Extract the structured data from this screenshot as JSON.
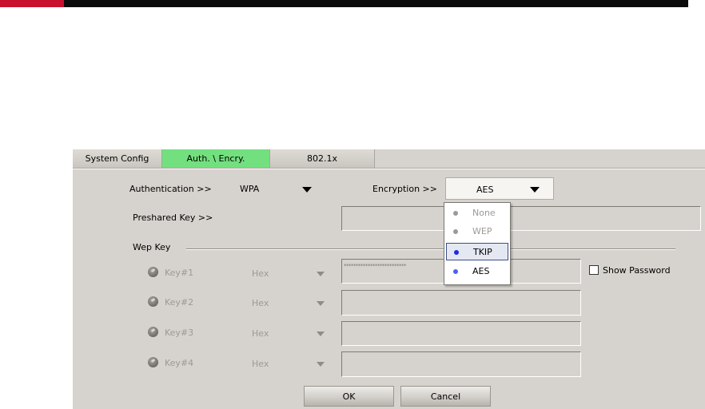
{
  "tabs": [
    {
      "label": "System Config",
      "active": false
    },
    {
      "label": "Auth. \\ Encry.",
      "active": true
    },
    {
      "label": "802.1x",
      "active": false
    }
  ],
  "authentication": {
    "label": "Authentication >>",
    "value": "WPA"
  },
  "encryption": {
    "label": "Encryption >>",
    "value": "AES",
    "options": [
      {
        "label": "None",
        "enabled": false,
        "selected": false,
        "dot_color": "#9a9a9a"
      },
      {
        "label": "WEP",
        "enabled": false,
        "selected": false,
        "dot_color": "#9a9a9a"
      },
      {
        "label": "TKIP",
        "enabled": true,
        "selected": true,
        "dot_color": "#1f2be0"
      },
      {
        "label": "AES",
        "enabled": true,
        "selected": false,
        "dot_color": "#5060f0"
      }
    ]
  },
  "preshared": {
    "label": "Preshared Key >>",
    "value": ""
  },
  "wep": {
    "group_label": "Wep Key",
    "keys": [
      {
        "label": "Key#1",
        "format": "Hex",
        "value": "**************************"
      },
      {
        "label": "Key#2",
        "format": "Hex",
        "value": ""
      },
      {
        "label": "Key#3",
        "format": "Hex",
        "value": ""
      },
      {
        "label": "Key#4",
        "format": "Hex",
        "value": ""
      }
    ]
  },
  "show_password": {
    "label": "Show Password",
    "checked": false
  },
  "buttons": {
    "ok": "OK",
    "cancel": "Cancel"
  },
  "colors": {
    "active_tab": "#73e07f",
    "dialog_bg": "#d6d3ce",
    "header_red": "#c8102e",
    "header_black": "#0b0b0b"
  }
}
